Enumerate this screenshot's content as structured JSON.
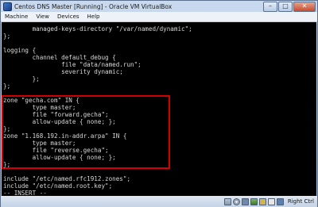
{
  "window": {
    "title": "Centos DNS Master [Running] - Oracle VM VirtualBox",
    "controls": {
      "minimize": "–",
      "maximize": "□",
      "close": "✕"
    }
  },
  "menubar": {
    "items": [
      "Machine",
      "View",
      "Devices",
      "Help"
    ]
  },
  "terminal": {
    "lines": [
      "        managed-keys-directory \"/var/named/dynamic\";",
      "};",
      "",
      "logging {",
      "        channel default_debug {",
      "                file \"data/named.run\";",
      "                severity dynamic;",
      "        };",
      "};",
      "",
      "zone \"gecha.com\" IN {",
      "        type master;",
      "        file \"forward.gecha\";",
      "        allow-update { none; };",
      "};",
      "zone \"1.168.192.in-addr.arpa\" IN {",
      "        type master;",
      "        file \"reverse.gecha\";",
      "        allow-update { none; };",
      "};",
      "",
      "include \"/etc/named.rfc1912.zones\";",
      "include \"/etc/named.root.key\";",
      "-- INSERT --"
    ],
    "highlight_color": "#d40000",
    "text_color": "#d8d8d8",
    "background": "#000000"
  },
  "statusbar": {
    "host_key_label": "Right Ctrl",
    "icons": [
      "hdd-icon",
      "cd-icon",
      "usb-icon",
      "network-icon",
      "shared-folder-icon",
      "mouse-integration-icon",
      "keyboard-capture-icon"
    ]
  }
}
